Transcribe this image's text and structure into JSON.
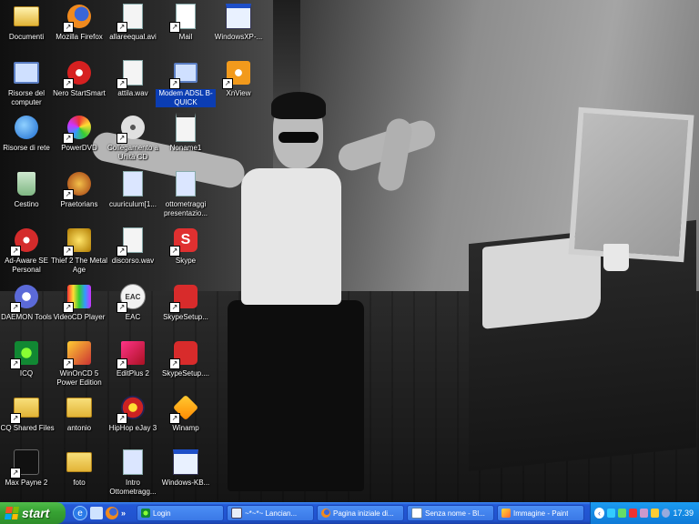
{
  "desktop": {
    "icons": [
      {
        "label": "Documenti",
        "icon": "folder-docs-icon"
      },
      {
        "label": "Mozilla Firefox",
        "icon": "firefox-icon"
      },
      {
        "label": "allareequal.avi",
        "icon": "video-file-icon"
      },
      {
        "label": "Mail",
        "icon": "mail-icon"
      },
      {
        "label": "WindowsXP-...",
        "icon": "exe-icon"
      },
      {
        "label": "Risorse del computer",
        "icon": "my-computer-icon"
      },
      {
        "label": "Nero StartSmart",
        "icon": "nero-icon"
      },
      {
        "label": "attila.wav",
        "icon": "audio-file-icon"
      },
      {
        "label": "Modem ADSL B-QUICK",
        "icon": "modem-icon"
      },
      {
        "label": "XnView",
        "icon": "xnview-icon"
      },
      {
        "label": "Risorse di rete",
        "icon": "network-icon"
      },
      {
        "label": "PowerDVD",
        "icon": "powerdvd-icon"
      },
      {
        "label": "Collegamento a Unità CD",
        "icon": "cd-drive-icon"
      },
      {
        "label": "Noname1",
        "icon": "document-icon"
      },
      {
        "label": "Cestino",
        "icon": "recycle-bin-icon"
      },
      {
        "label": "Praetorians",
        "icon": "game-icon"
      },
      {
        "label": "cuuriculum[1...",
        "icon": "document-icon"
      },
      {
        "label": "ottometraggi presentazio...",
        "icon": "document-icon"
      },
      {
        "label": "Ad-Aware SE Personal",
        "icon": "adaware-icon"
      },
      {
        "label": "Thief 2 The Metal Age",
        "icon": "game-icon"
      },
      {
        "label": "discorso.wav",
        "icon": "audio-file-icon"
      },
      {
        "label": "Skype",
        "icon": "skype-icon"
      },
      {
        "label": "DAEMON Tools",
        "icon": "daemon-tools-icon"
      },
      {
        "label": "VideoCD Player",
        "icon": "videocd-icon"
      },
      {
        "label": "EAC",
        "icon": "eac-icon"
      },
      {
        "label": "SkypeSetup...",
        "icon": "installer-icon"
      },
      {
        "label": "ICQ",
        "icon": "icq-icon"
      },
      {
        "label": "WinOnCD 5 Power Edition",
        "icon": "winoncd-icon"
      },
      {
        "label": "EditPlus 2",
        "icon": "editplus-icon"
      },
      {
        "label": "SkypeSetup....",
        "icon": "installer-icon"
      },
      {
        "label": "ICQ Shared Files",
        "icon": "icq-folder-icon"
      },
      {
        "label": "antonio",
        "icon": "folder-icon"
      },
      {
        "label": "HipHop eJay 3",
        "icon": "ejay-icon"
      },
      {
        "label": "Winamp",
        "icon": "winamp-icon"
      },
      {
        "label": "Max Payne 2",
        "icon": "max-payne-icon"
      },
      {
        "label": "foto",
        "icon": "folder-icon"
      },
      {
        "label": "Intro Ottometragg...",
        "icon": "document-icon"
      },
      {
        "label": "Windows-KB...",
        "icon": "exe-icon"
      }
    ]
  },
  "taskbar": {
    "start_label": "start",
    "quick_launch": [
      "ie-icon",
      "desktop-icon",
      "firefox-icon"
    ],
    "overflow_label": "»",
    "tasks": [
      {
        "label": "Login",
        "icon": "icq-icon"
      },
      {
        "label": "~*~*~ Lancian...",
        "icon": "window-icon"
      },
      {
        "label": "Pagina iniziale di...",
        "icon": "firefox-icon"
      },
      {
        "label": "Senza nome - Bl...",
        "icon": "notepad-icon"
      },
      {
        "label": "Immagine - Paint",
        "icon": "paint-icon"
      }
    ],
    "tray_expand": "‹",
    "clock": "17.39"
  },
  "colors": {
    "taskbar_blue": "#2459d8",
    "start_green": "#37a233",
    "tray_blue": "#0f7ad8",
    "selection_blue": "#0b3db3"
  }
}
